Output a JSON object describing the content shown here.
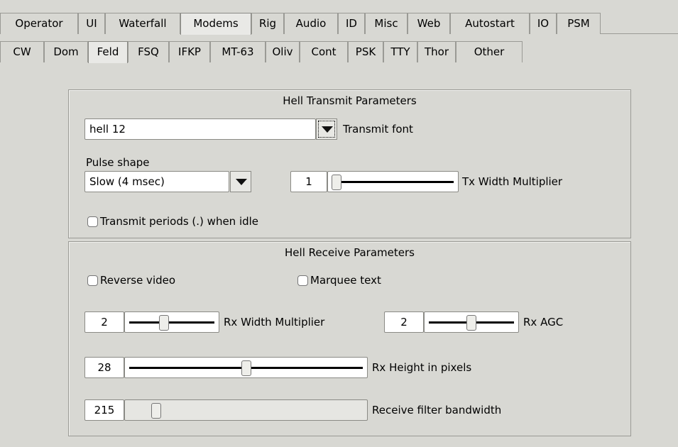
{
  "tabs_top": [
    "Operator",
    "UI",
    "Waterfall",
    "Modems",
    "Rig",
    "Audio",
    "ID",
    "Misc",
    "Web",
    "Autostart",
    "IO",
    "PSM"
  ],
  "tabs_top_active": "Modems",
  "tabs_sub": [
    "CW",
    "Dom",
    "Feld",
    "FSQ",
    "IFKP",
    "MT-63",
    "Oliv",
    "Cont",
    "PSK",
    "TTY",
    "Thor",
    "Other"
  ],
  "tabs_sub_active": "Feld",
  "transmit": {
    "title": "Hell Transmit Parameters",
    "font_value": "hell   12",
    "font_label": "Transmit font",
    "pulse_label": "Pulse shape",
    "pulse_value": "Slow (4 msec)",
    "width_value": "1",
    "width_label": "Tx Width Multiplier",
    "width_slider_fraction": 0.0,
    "periods_label": "Transmit periods (.) when idle",
    "periods_checked": false
  },
  "receive": {
    "title": "Hell Receive Parameters",
    "reverse_label": "Reverse video",
    "reverse_checked": false,
    "marquee_label": "Marquee text",
    "marquee_checked": false,
    "width_value": "2",
    "width_label": "Rx Width Multiplier",
    "width_slider_fraction": 0.4,
    "agc_value": "2",
    "agc_label": "Rx AGC",
    "agc_slider_fraction": 0.5,
    "height_value": "28",
    "height_label": "Rx Height in pixels",
    "height_slider_fraction": 0.5,
    "bandwidth_value": "215",
    "bandwidth_label": "Receive filter bandwidth",
    "bandwidth_slider_fraction": 0.1
  }
}
